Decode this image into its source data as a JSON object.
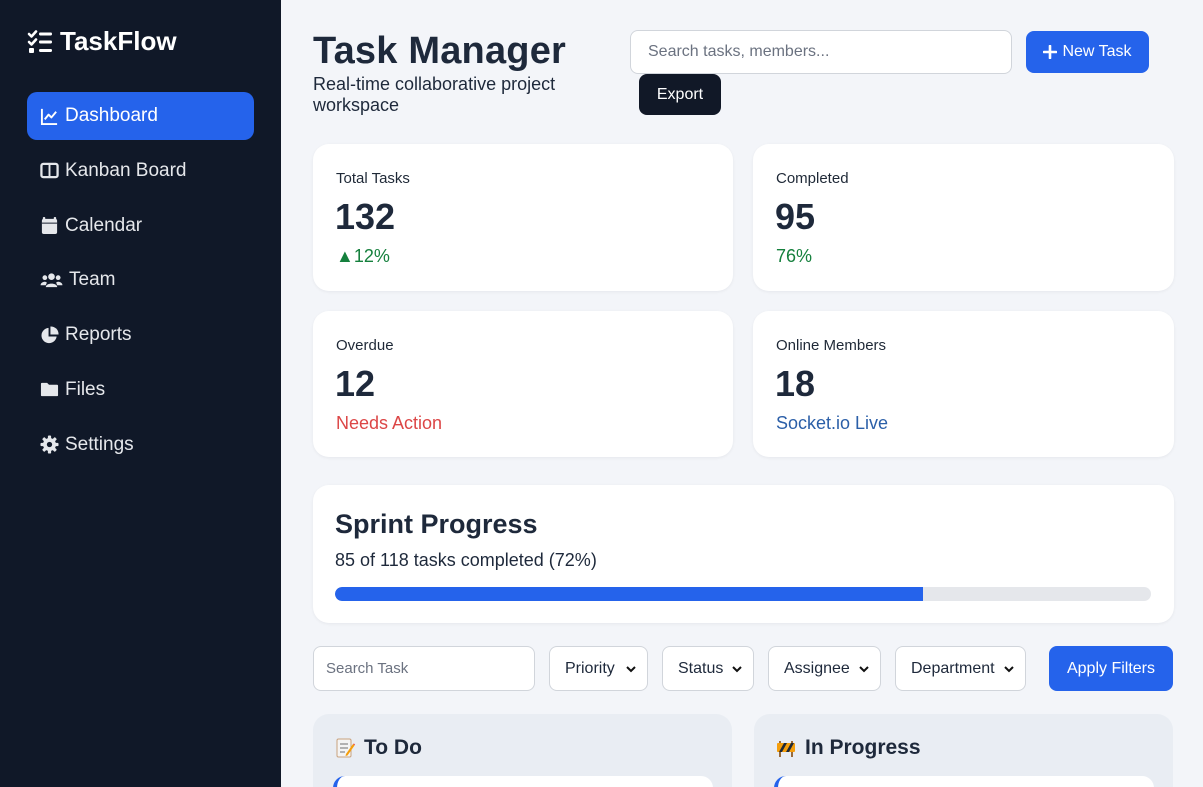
{
  "brand": {
    "name": "TaskFlow",
    "icon": "checklist-icon"
  },
  "sidebar": {
    "items": [
      {
        "label": "Dashboard",
        "icon": "chart-line-icon",
        "active": true
      },
      {
        "label": "Kanban Board",
        "icon": "columns-icon",
        "active": false
      },
      {
        "label": "Calendar",
        "icon": "calendar-icon",
        "active": false
      },
      {
        "label": "Team",
        "icon": "users-icon",
        "active": false
      },
      {
        "label": "Reports",
        "icon": "pie-chart-icon",
        "active": false
      },
      {
        "label": "Files",
        "icon": "folder-icon",
        "active": false
      },
      {
        "label": "Settings",
        "icon": "gear-icon",
        "active": false
      }
    ]
  },
  "header": {
    "title": "Task Manager",
    "subtitle": "Real-time collaborative project workspace",
    "search_placeholder": "Search tasks, members...",
    "new_task_label": "New Task",
    "export_label": "Export"
  },
  "stats": [
    {
      "label": "Total Tasks",
      "value": "132",
      "note": "▲12%",
      "note_color": "#15803d"
    },
    {
      "label": "Completed",
      "value": "95",
      "note": "76%",
      "note_color": "#15803d"
    },
    {
      "label": "Overdue",
      "value": "12",
      "note": "Needs Action",
      "note_color": "#dc4646"
    },
    {
      "label": "Online Members",
      "value": "18",
      "note": "Socket.io Live",
      "note_color": "#2b5fa8"
    }
  ],
  "sprint": {
    "title": "Sprint Progress",
    "summary": "85 of 118 tasks completed (72%)",
    "progress_percent": 72
  },
  "filters": {
    "search_placeholder": "Search Task",
    "priority": "Priority",
    "status": "Status",
    "assignee": "Assignee",
    "department": "Department",
    "apply_label": "Apply Filters"
  },
  "columns": [
    {
      "title": "To Do",
      "icon": "memo-icon"
    },
    {
      "title": "In Progress",
      "icon": "construction-icon"
    }
  ],
  "colors": {
    "sidebar_bg": "#101828",
    "accent": "#2563eb",
    "page_bg": "#f3f5f9",
    "dark_button": "#111827"
  }
}
